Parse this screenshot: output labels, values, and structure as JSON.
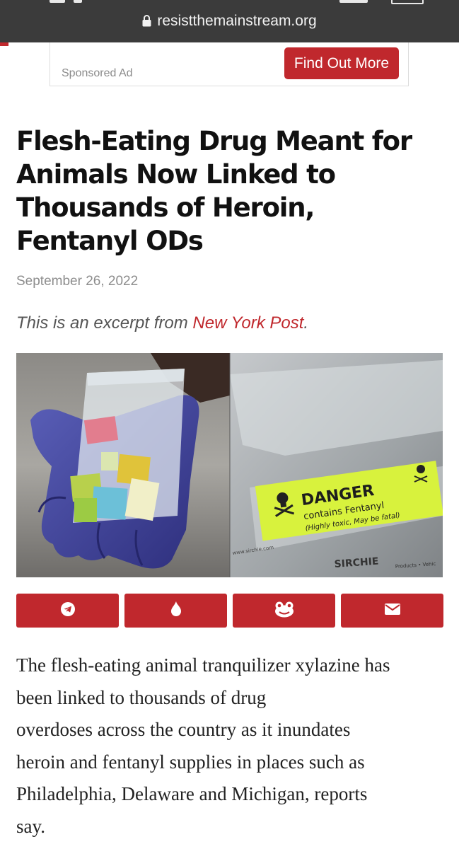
{
  "browser": {
    "url": "resistthemainstream.org"
  },
  "ad": {
    "label": "Sponsored Ad",
    "button_label": "Find Out More"
  },
  "article": {
    "headline": "Flesh-Eating Drug Meant for Animals Now Linked to Thousands of Heroin, Fentanyl ODs",
    "date": "September 26, 2022",
    "excerpt_prefix": "This is an excerpt from ",
    "source_link": "New York Post",
    "excerpt_suffix": ".",
    "body_lines": [
      "The flesh-eating animal tranquilizer xylazine has",
      "been linked to thousands of drug",
      "overdoses across the country as it inundates",
      "heroin and fentanyl supplies in places such as",
      "Philadelphia, Delaware and Michigan, reports",
      "say."
    ]
  },
  "photo": {
    "label_title": "DANGER",
    "label_line1": "contains Fentanyl",
    "label_line2": "(Highly toxic, May be fatal)",
    "brand": "SIRCHIE",
    "brand_sub": "Products • Vehic",
    "watermark": "www.sirchie.com"
  },
  "share": {
    "icons": [
      "telegram-icon",
      "fire-icon",
      "frog-icon",
      "mail-icon"
    ]
  },
  "colors": {
    "accent": "#c0282d",
    "topbar": "#3b3b3b"
  }
}
